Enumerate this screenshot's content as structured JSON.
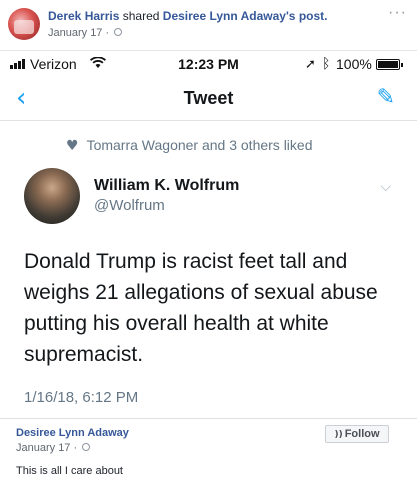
{
  "post_header": {
    "sharer": "Derek Harris",
    "action_text": "shared",
    "original_author": "Desiree Lynn Adaway's",
    "object": "post.",
    "date": "January 17 ·",
    "privacy_icon": "globe-icon",
    "more": "···"
  },
  "status_bar": {
    "carrier": "Verizon",
    "time": "12:23 PM",
    "battery_pct": "100%",
    "battery_level": 1.0
  },
  "nav": {
    "back": "‹",
    "title": "Tweet",
    "compose_icon": "compose-tweet-icon"
  },
  "tweet": {
    "liked_by": "Tomarra Wagoner and 3 others liked",
    "author_name": "William K. Wolfrum",
    "author_handle": "@Wolfrum",
    "text": "Donald Trump is racist feet tall and weighs 21 allegations of sexual abuse putting his overall health at white supremacist.",
    "timestamp": "1/16/18, 6:12 PM"
  },
  "shared_post": {
    "author": "Desiree Lynn Adaway",
    "date": "January 17 ·",
    "follow_label": "Follow",
    "caption": "This is all I care about"
  },
  "colors": {
    "fb_link": "#365899",
    "twitter_blue": "#1da1f2",
    "muted_gray": "#657786"
  }
}
